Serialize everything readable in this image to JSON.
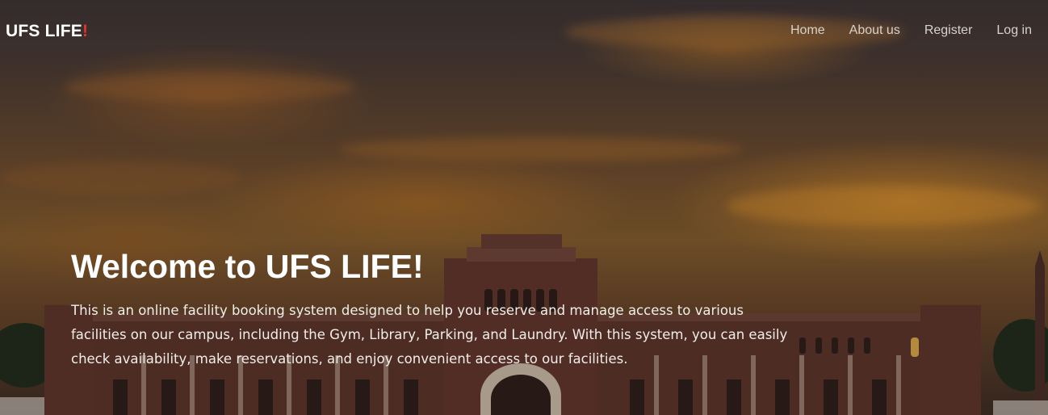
{
  "brand": {
    "name": "UFS LIFE",
    "accent": "!",
    "accent_color": "#e0342f"
  },
  "nav": {
    "items": [
      {
        "label": "Home"
      },
      {
        "label": "About us"
      },
      {
        "label": "Register"
      },
      {
        "label": "Log in"
      }
    ]
  },
  "hero": {
    "title": "Welcome to UFS LIFE!",
    "description": "This is an online facility booking system designed to help you reserve and manage access to various facilities on our campus, including the Gym, Library, Parking, and Laundry. With this system, you can easily check availability, make reservations, and enjoy convenient access to our facilities."
  }
}
